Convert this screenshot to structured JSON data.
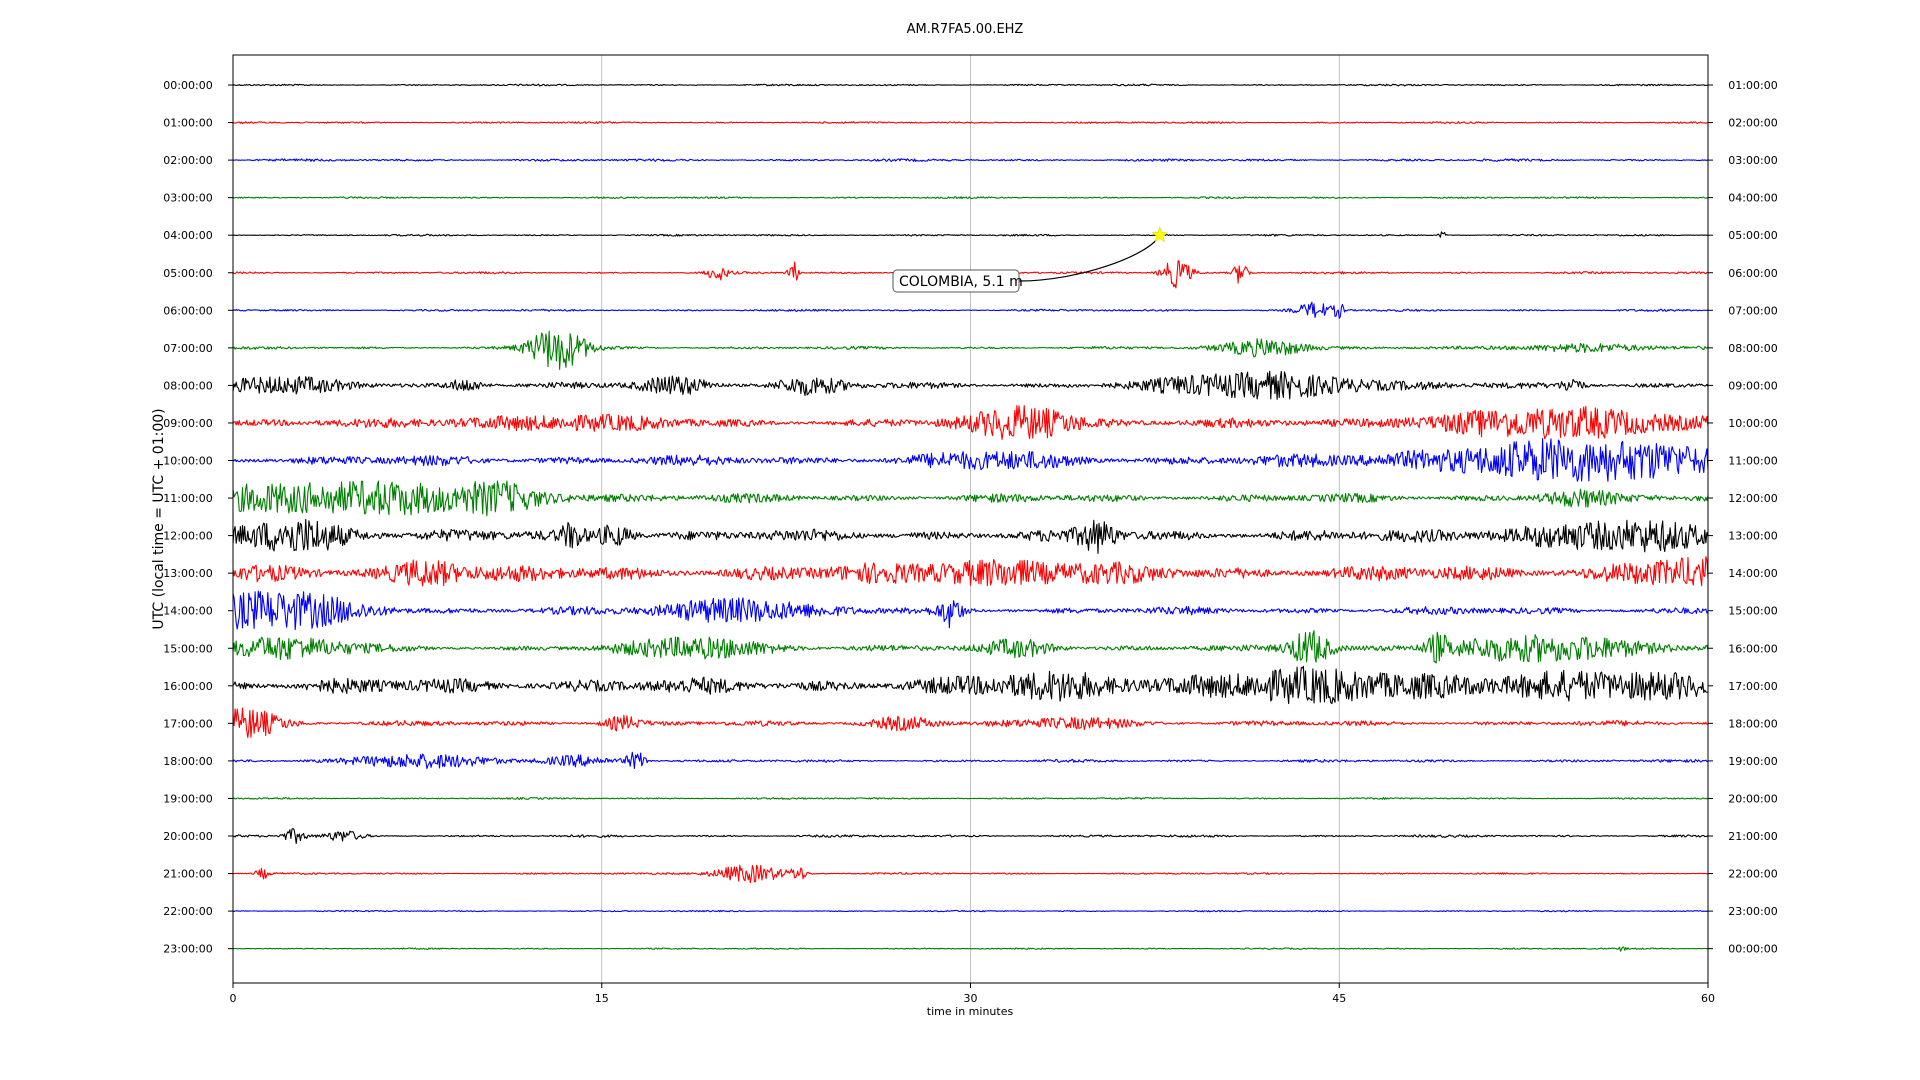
{
  "chart_data": {
    "type": "line",
    "title": "AM.R7FA5.00.EHZ",
    "xlabel": "time in minutes",
    "ylabel": "UTC (local time = UTC + 01:00)",
    "xlim": [
      0,
      60
    ],
    "x_ticks": [
      0,
      15,
      30,
      45,
      60
    ],
    "x_tick_labels": [
      "0",
      "15",
      "30",
      "45",
      "60"
    ],
    "grid": "vertical",
    "colors": [
      "#000000",
      "#ff0000",
      "#0000ff",
      "#008000"
    ],
    "left_labels": [
      "00:00:00",
      "01:00:00",
      "02:00:00",
      "03:00:00",
      "04:00:00",
      "05:00:00",
      "06:00:00",
      "07:00:00",
      "08:00:00",
      "09:00:00",
      "10:00:00",
      "11:00:00",
      "12:00:00",
      "13:00:00",
      "14:00:00",
      "15:00:00",
      "16:00:00",
      "17:00:00",
      "18:00:00",
      "19:00:00",
      "20:00:00",
      "21:00:00",
      "22:00:00",
      "23:00:00"
    ],
    "right_labels": [
      "01:00:00",
      "02:00:00",
      "03:00:00",
      "04:00:00",
      "05:00:00",
      "06:00:00",
      "07:00:00",
      "08:00:00",
      "09:00:00",
      "10:00:00",
      "11:00:00",
      "12:00:00",
      "13:00:00",
      "14:00:00",
      "15:00:00",
      "16:00:00",
      "17:00:00",
      "18:00:00",
      "19:00:00",
      "20:00:00",
      "21:00:00",
      "22:00:00",
      "23:00:00",
      "00:00:00"
    ],
    "rows": [
      {
        "base": 0.05,
        "bursts": []
      },
      {
        "base": 0.05,
        "bursts": []
      },
      {
        "base": 0.07,
        "bursts": []
      },
      {
        "base": 0.05,
        "bursts": []
      },
      {
        "base": 0.05,
        "bursts": [
          {
            "t": 49.2,
            "a": 0.2,
            "w": 0.1
          }
        ]
      },
      {
        "base": 0.06,
        "bursts": [
          {
            "t": 19.7,
            "a": 0.35,
            "w": 0.3
          },
          {
            "t": 22.8,
            "a": 0.55,
            "w": 0.15
          },
          {
            "t": 38.4,
            "a": 0.75,
            "w": 0.4
          },
          {
            "t": 41.0,
            "a": 0.6,
            "w": 0.2
          }
        ]
      },
      {
        "base": 0.06,
        "bursts": [
          {
            "t": 44.0,
            "a": 0.4,
            "w": 0.5
          },
          {
            "t": 45.0,
            "a": 0.35,
            "w": 0.15
          }
        ]
      },
      {
        "base": 0.08,
        "bursts": [
          {
            "t": 13.2,
            "a": 1.1,
            "w": 0.8
          },
          {
            "t": 42.0,
            "a": 0.45,
            "w": 1.2
          },
          {
            "t": 55.0,
            "a": 0.2,
            "w": 2.0
          }
        ]
      },
      {
        "base": 0.18,
        "bursts": [
          {
            "t": 1.5,
            "a": 0.35,
            "w": 2.0
          },
          {
            "t": 9.5,
            "a": 0.3,
            "w": 0.5
          },
          {
            "t": 18.0,
            "a": 0.4,
            "w": 1.0
          },
          {
            "t": 23.5,
            "a": 0.4,
            "w": 1.0
          },
          {
            "t": 42.0,
            "a": 0.6,
            "w": 3.0
          },
          {
            "t": 54.5,
            "a": 0.4,
            "w": 0.3
          }
        ]
      },
      {
        "base": 0.25,
        "bursts": [
          {
            "t": 13.0,
            "a": 0.3,
            "w": 3.0
          },
          {
            "t": 32.3,
            "a": 0.8,
            "w": 1.5
          },
          {
            "t": 54.0,
            "a": 0.65,
            "w": 4.0
          }
        ]
      },
      {
        "base": 0.3,
        "bursts": [
          {
            "t": 31.0,
            "a": 0.3,
            "w": 2.0
          },
          {
            "t": 55.0,
            "a": 0.9,
            "w": 5.0
          }
        ]
      },
      {
        "base": 0.25,
        "bursts": [
          {
            "t": 4.5,
            "a": 0.75,
            "w": 5.0
          },
          {
            "t": 10.8,
            "a": 0.35,
            "w": 1.0
          },
          {
            "t": 54.5,
            "a": 0.3,
            "w": 1.0
          }
        ]
      },
      {
        "base": 0.35,
        "bursts": [
          {
            "t": 2.5,
            "a": 0.8,
            "w": 1.5
          },
          {
            "t": 13.8,
            "a": 0.5,
            "w": 0.3
          },
          {
            "t": 15.5,
            "a": 0.5,
            "w": 0.5
          },
          {
            "t": 35.2,
            "a": 0.7,
            "w": 0.5
          },
          {
            "t": 56.0,
            "a": 0.6,
            "w": 3.0
          }
        ]
      },
      {
        "base": 0.45,
        "bursts": [
          {
            "t": 8.0,
            "a": 0.6,
            "w": 1.0
          },
          {
            "t": 31.0,
            "a": 0.5,
            "w": 3.0
          },
          {
            "t": 59.0,
            "a": 0.5,
            "w": 2.0
          }
        ]
      },
      {
        "base": 0.22,
        "bursts": [
          {
            "t": 1.5,
            "a": 0.9,
            "w": 2.5
          },
          {
            "t": 20.5,
            "a": 0.6,
            "w": 2.0
          },
          {
            "t": 29.2,
            "a": 0.7,
            "w": 0.3
          }
        ]
      },
      {
        "base": 0.18,
        "bursts": [
          {
            "t": 2.0,
            "a": 0.5,
            "w": 2.0
          },
          {
            "t": 19.0,
            "a": 0.5,
            "w": 2.0
          },
          {
            "t": 32.0,
            "a": 0.4,
            "w": 1.0
          },
          {
            "t": 43.8,
            "a": 0.9,
            "w": 0.6
          },
          {
            "t": 49.0,
            "a": 0.6,
            "w": 0.3
          },
          {
            "t": 53.5,
            "a": 0.6,
            "w": 3.0
          }
        ]
      },
      {
        "base": 0.45,
        "bursts": [
          {
            "t": 33.5,
            "a": 0.5,
            "w": 2.0
          },
          {
            "t": 45.0,
            "a": 0.6,
            "w": 4.0
          },
          {
            "t": 57.0,
            "a": 0.5,
            "w": 3.0
          }
        ]
      },
      {
        "base": 0.15,
        "bursts": [
          {
            "t": 0.5,
            "a": 0.75,
            "w": 1.0
          },
          {
            "t": 15.8,
            "a": 0.35,
            "w": 0.5
          },
          {
            "t": 27.3,
            "a": 0.3,
            "w": 1.0
          },
          {
            "t": 34.5,
            "a": 0.25,
            "w": 1.5
          }
        ]
      },
      {
        "base": 0.08,
        "bursts": [
          {
            "t": 7.5,
            "a": 0.35,
            "w": 2.0
          },
          {
            "t": 14.0,
            "a": 0.25,
            "w": 1.0
          },
          {
            "t": 16.4,
            "a": 0.45,
            "w": 0.3
          }
        ]
      },
      {
        "base": 0.05,
        "bursts": []
      },
      {
        "base": 0.07,
        "bursts": [
          {
            "t": 2.5,
            "a": 0.35,
            "w": 0.3
          },
          {
            "t": 4.5,
            "a": 0.25,
            "w": 0.5
          }
        ]
      },
      {
        "base": 0.05,
        "bursts": [
          {
            "t": 1.2,
            "a": 0.25,
            "w": 0.2
          },
          {
            "t": 21.0,
            "a": 0.45,
            "w": 1.0
          },
          {
            "t": 23.0,
            "a": 0.35,
            "w": 0.2
          }
        ]
      },
      {
        "base": 0.04,
        "bursts": []
      },
      {
        "base": 0.04,
        "bursts": [
          {
            "t": 56.5,
            "a": 0.12,
            "w": 0.1
          }
        ]
      }
    ],
    "annotation": {
      "text": "COLOMBIA, 5.1 m",
      "row": 4,
      "t": 37.7,
      "marker": "star",
      "marker_color": "#ffff00"
    }
  }
}
